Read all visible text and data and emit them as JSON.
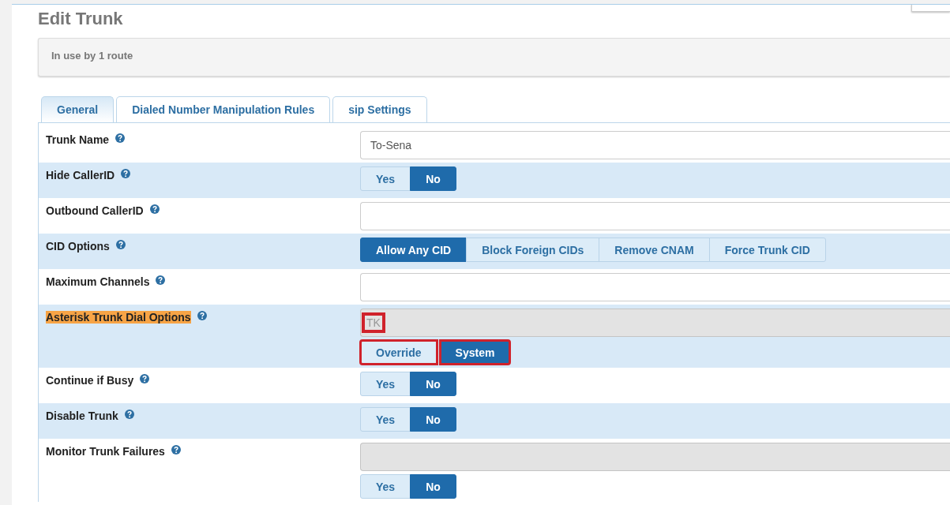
{
  "title": "Edit Trunk",
  "info": "In use by 1 route",
  "tabs": [
    {
      "label": "General",
      "selected": true
    },
    {
      "label": "Dialed Number Manipulation Rules",
      "selected": false
    },
    {
      "label": "sip Settings",
      "selected": false
    }
  ],
  "rows": [
    {
      "label": "Trunk Name",
      "highlighted": false,
      "field": {
        "value": "To-Sena",
        "readonly": false
      }
    },
    {
      "label": "Hide CallerID",
      "highlighted": false,
      "options": [
        {
          "label": "Yes",
          "selected": false,
          "outlined": false
        },
        {
          "label": "No",
          "selected": true,
          "outlined": false
        }
      ]
    },
    {
      "label": "Outbound CallerID",
      "highlighted": false,
      "field": {
        "readonly": false
      }
    },
    {
      "label": "CID Options",
      "highlighted": false,
      "options": [
        {
          "label": "Allow Any CID",
          "selected": true,
          "outlined": false
        },
        {
          "label": "Block Foreign CIDs",
          "selected": false,
          "outlined": false
        },
        {
          "label": "Remove CNAM",
          "selected": false,
          "outlined": false
        },
        {
          "label": "Force Trunk CID",
          "selected": false,
          "outlined": false
        }
      ]
    },
    {
      "label": "Maximum Channels",
      "highlighted": false,
      "field": {
        "readonly": false
      }
    },
    {
      "label": "Asterisk Trunk Dial Options",
      "highlighted": true,
      "field": {
        "value": "TK",
        "readonly": true,
        "outlined": true
      },
      "options": [
        {
          "label": "Override",
          "selected": false,
          "outlined": true
        },
        {
          "label": "System",
          "selected": true,
          "outlined": true
        }
      ]
    },
    {
      "label": "Continue if Busy",
      "highlighted": false,
      "options": [
        {
          "label": "Yes",
          "selected": false,
          "outlined": false
        },
        {
          "label": "No",
          "selected": true,
          "outlined": false
        }
      ]
    },
    {
      "label": "Disable Trunk",
      "highlighted": false,
      "options": [
        {
          "label": "Yes",
          "selected": false,
          "outlined": false
        },
        {
          "label": "No",
          "selected": true,
          "outlined": false
        }
      ]
    },
    {
      "label": "Monitor Trunk Failures",
      "highlighted": false,
      "field": {
        "readonly": true
      },
      "options": [
        {
          "label": "Yes",
          "selected": false,
          "outlined": false
        },
        {
          "label": "No",
          "selected": true,
          "outlined": false
        }
      ]
    }
  ]
}
